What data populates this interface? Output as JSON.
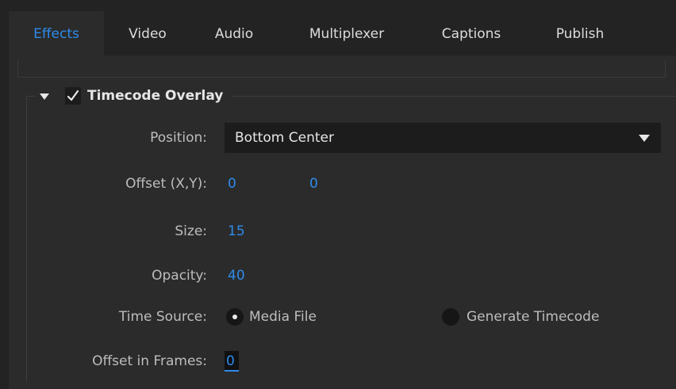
{
  "tabs": [
    {
      "label": "Effects",
      "active": true
    },
    {
      "label": "Video",
      "active": false
    },
    {
      "label": "Audio",
      "active": false
    },
    {
      "label": "Multiplexer",
      "active": false
    },
    {
      "label": "Captions",
      "active": false
    },
    {
      "label": "Publish",
      "active": false
    }
  ],
  "group": {
    "title": "Timecode Overlay",
    "enabled": true,
    "expanded": true
  },
  "fields": {
    "position_label": "Position:",
    "position_value": "Bottom Center",
    "offset_label": "Offset (X,Y):",
    "offset_x": "0",
    "offset_y": "0",
    "size_label": "Size:",
    "size_value": "15",
    "opacity_label": "Opacity:",
    "opacity_value": "40",
    "time_source_label": "Time Source:",
    "time_source_option_1": "Media File",
    "time_source_option_2": "Generate Timecode",
    "time_source_selected": "Media File",
    "offset_frames_label": "Offset in Frames:",
    "offset_frames_value": "0"
  },
  "colors": {
    "accent": "#2d8ceb",
    "panel": "#2b2b2b",
    "background": "#232323"
  },
  "icons": {
    "expand": "triangle-down-icon",
    "check": "checkmark-icon",
    "dropdown": "chevron-down-icon"
  }
}
